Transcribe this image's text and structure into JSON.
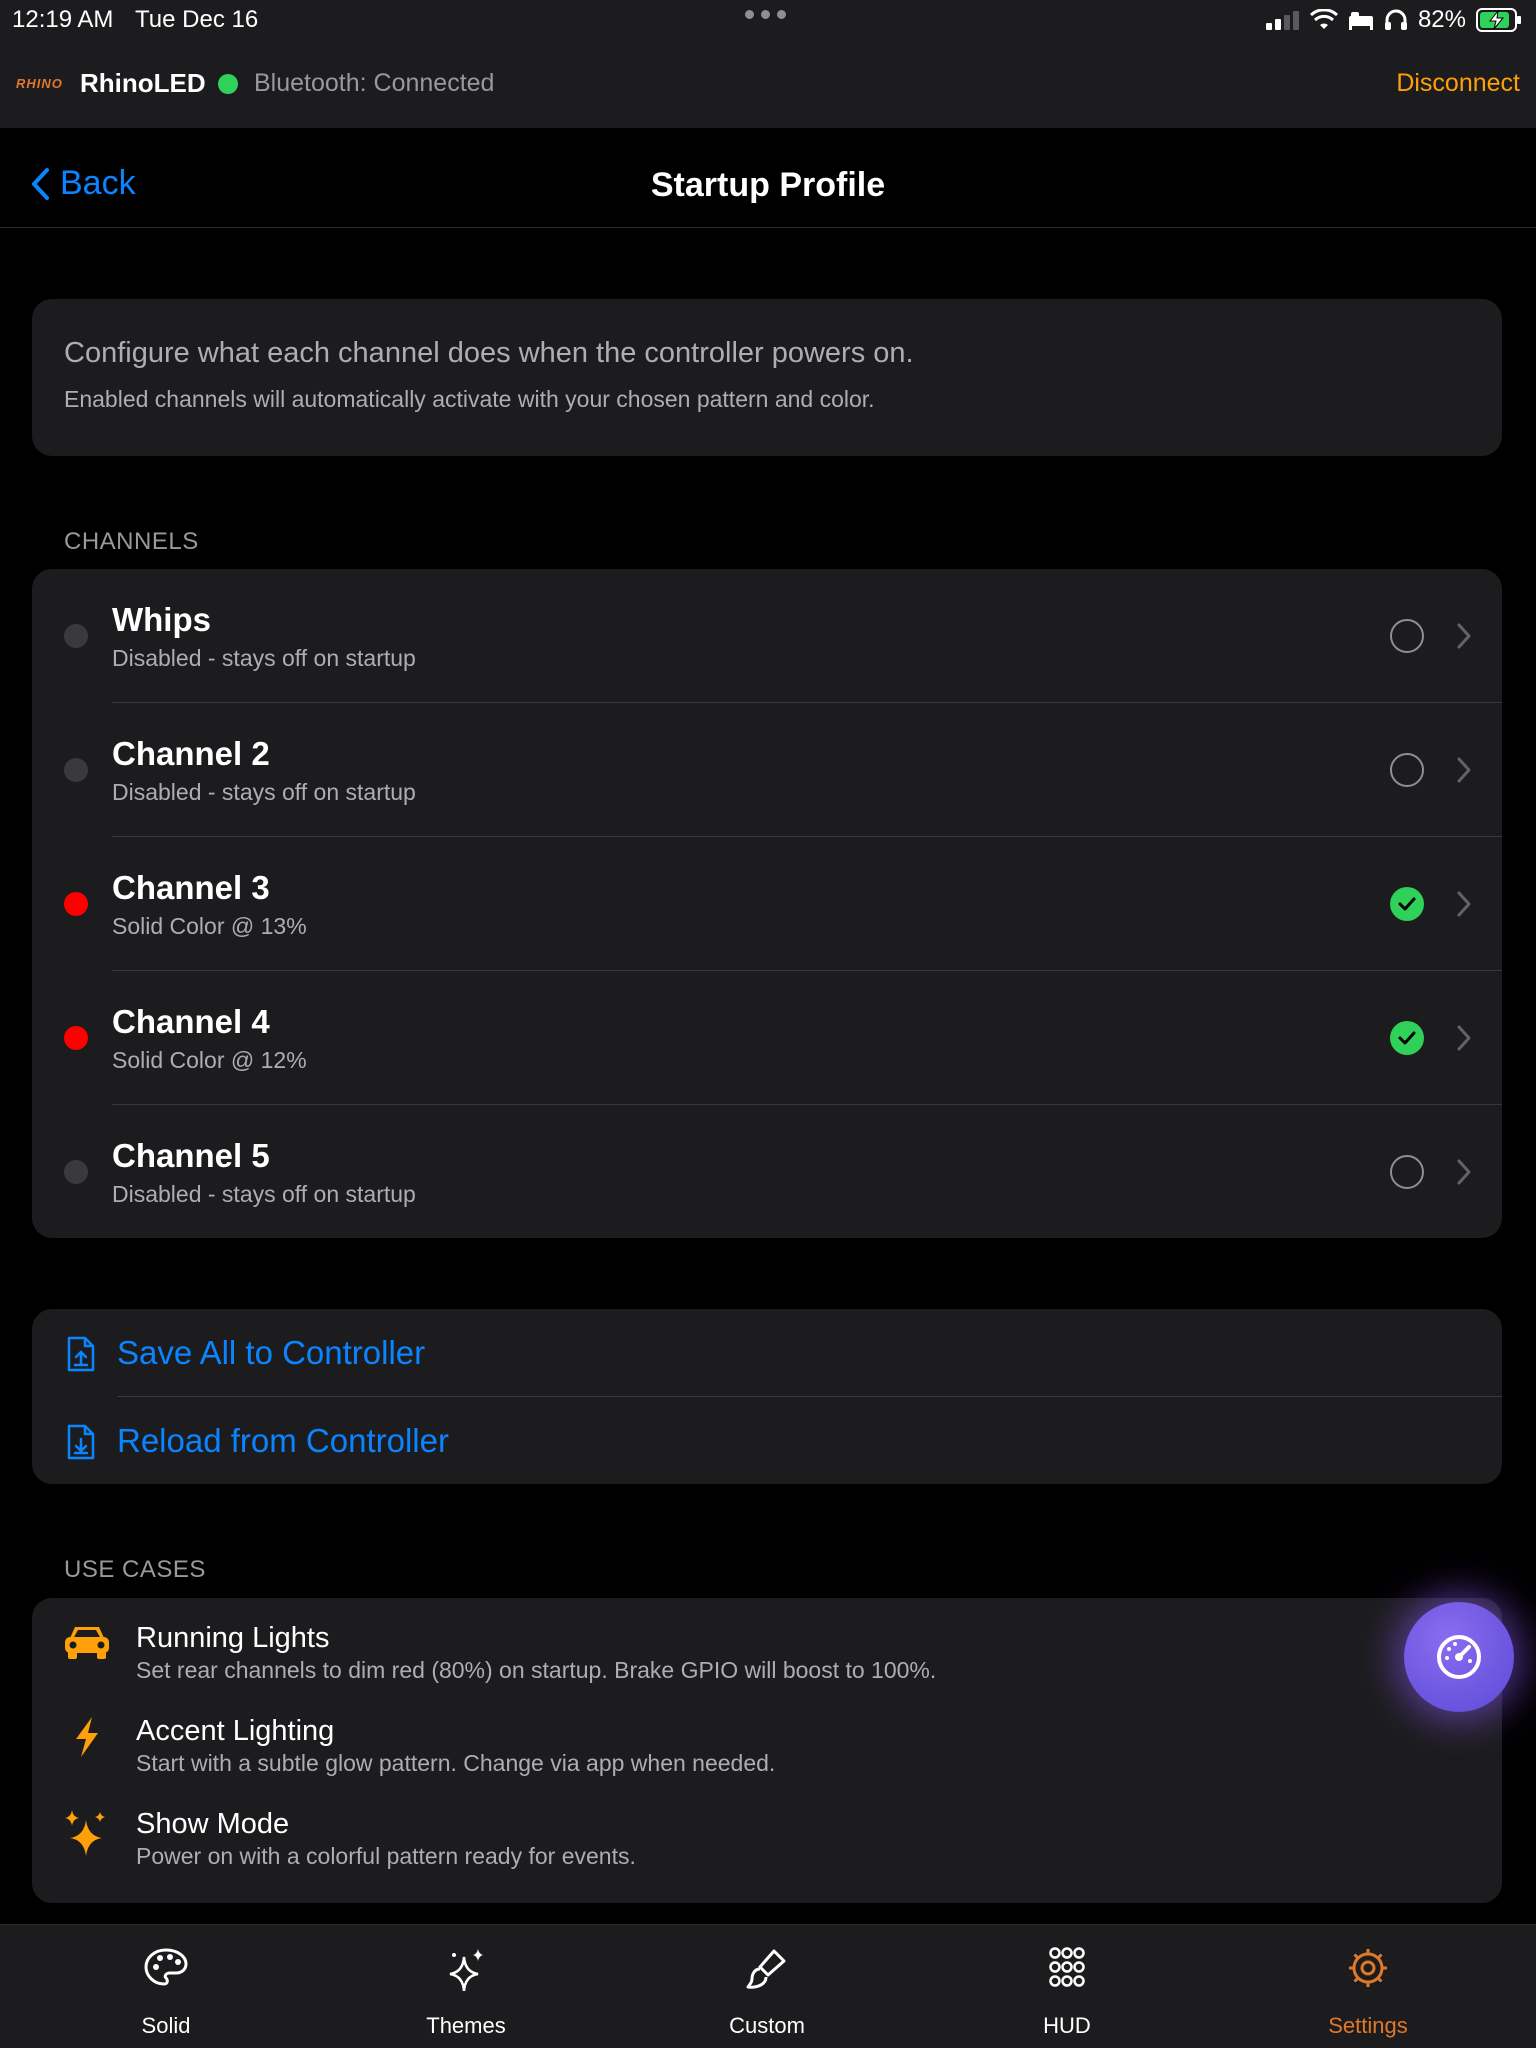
{
  "status_bar": {
    "time": "12:19 AM",
    "date": "Tue Dec 16",
    "battery": "82%"
  },
  "connection": {
    "logo": "RHINO",
    "app_name": "RhinoLED",
    "status": "Bluetooth: Connected",
    "disconnect_label": "Disconnect"
  },
  "nav": {
    "back_label": "Back",
    "title": "Startup Profile"
  },
  "info": {
    "title": "Configure what each channel does when the controller powers on.",
    "subtitle": "Enabled channels will automatically activate with your chosen pattern and color."
  },
  "channels_section": "CHANNELS",
  "channels": [
    {
      "name": "Whips",
      "sub": "Disabled - stays off on startup",
      "enabled": false,
      "dot_color": "#3a3a3c"
    },
    {
      "name": "Channel 2",
      "sub": "Disabled - stays off on startup",
      "enabled": false,
      "dot_color": "#3a3a3c"
    },
    {
      "name": "Channel 3",
      "sub": "Solid Color @ 13%",
      "enabled": true,
      "dot_color": "#ff0000"
    },
    {
      "name": "Channel 4",
      "sub": "Solid Color @ 12%",
      "enabled": true,
      "dot_color": "#ff0000"
    },
    {
      "name": "Channel 5",
      "sub": "Disabled - stays off on startup",
      "enabled": false,
      "dot_color": "#3a3a3c"
    }
  ],
  "actions": {
    "save_label": "Save All to Controller",
    "reload_label": "Reload from Controller"
  },
  "use_cases_section": "USE CASES",
  "use_cases": [
    {
      "title": "Running Lights",
      "sub": "Set rear channels to dim red (80%) on startup. Brake GPIO will boost to 100%.",
      "icon": "car-icon"
    },
    {
      "title": "Accent Lighting",
      "sub": "Start with a subtle glow pattern. Change via app when needed.",
      "icon": "bolt-icon"
    },
    {
      "title": "Show Mode",
      "sub": "Power on with a colorful pattern ready for events.",
      "icon": "sparkles-icon"
    }
  ],
  "tabs": [
    {
      "label": "Solid",
      "icon": "palette-icon",
      "active": false
    },
    {
      "label": "Themes",
      "icon": "sparkle-icon",
      "active": false
    },
    {
      "label": "Custom",
      "icon": "brush-icon",
      "active": false
    },
    {
      "label": "HUD",
      "icon": "grid-dots-icon",
      "active": false
    },
    {
      "label": "Settings",
      "icon": "gear-icon",
      "active": true
    }
  ],
  "colors": {
    "accent_blue": "#0a84ff",
    "accent_orange": "#ff9f0a",
    "enabled_green": "#30d158",
    "channel_red": "#ff0000",
    "fab_purple": "#6a55e0"
  }
}
